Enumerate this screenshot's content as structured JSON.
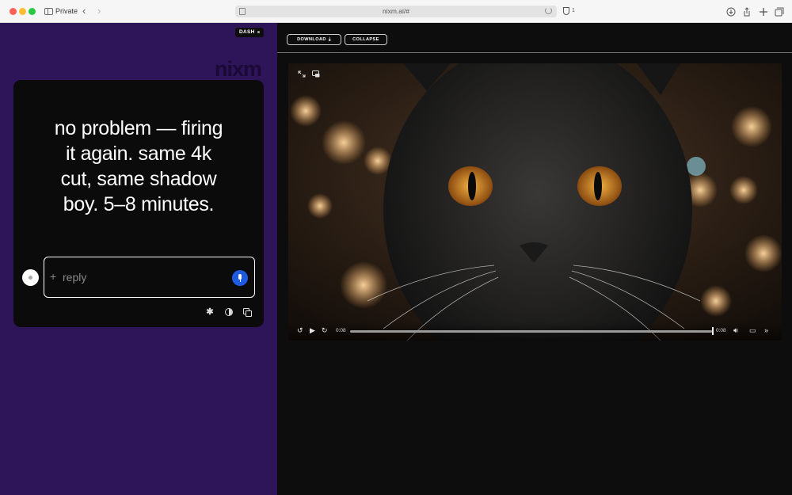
{
  "browser": {
    "private_label": "Private",
    "url": "nixm.ai/#",
    "shield_count": "1",
    "icons": [
      "sidebar-icon",
      "back-icon",
      "forward-icon",
      "reload-icon",
      "shield-icon",
      "download-icon",
      "share-icon",
      "new-tab-icon",
      "tabs-icon"
    ]
  },
  "sidebar": {
    "badge": "DASH",
    "brand": "nixm",
    "message_lines": [
      "no problem — firing",
      "it again. same 4k",
      "cut, same shadow",
      "boy. 5–8 minutes."
    ],
    "reply_placeholder": "reply",
    "plus_glyph": "+",
    "colors": {
      "panel": "#2e1458",
      "card": "#0b0b0b",
      "mic": "#1f5be0"
    }
  },
  "toolbar": {
    "download_label": "DOWNLOAD",
    "collapse_label": "COLLAPSE"
  },
  "video": {
    "current_time": "0:08",
    "remaining_time": "0:08",
    "progress": 1.0
  }
}
